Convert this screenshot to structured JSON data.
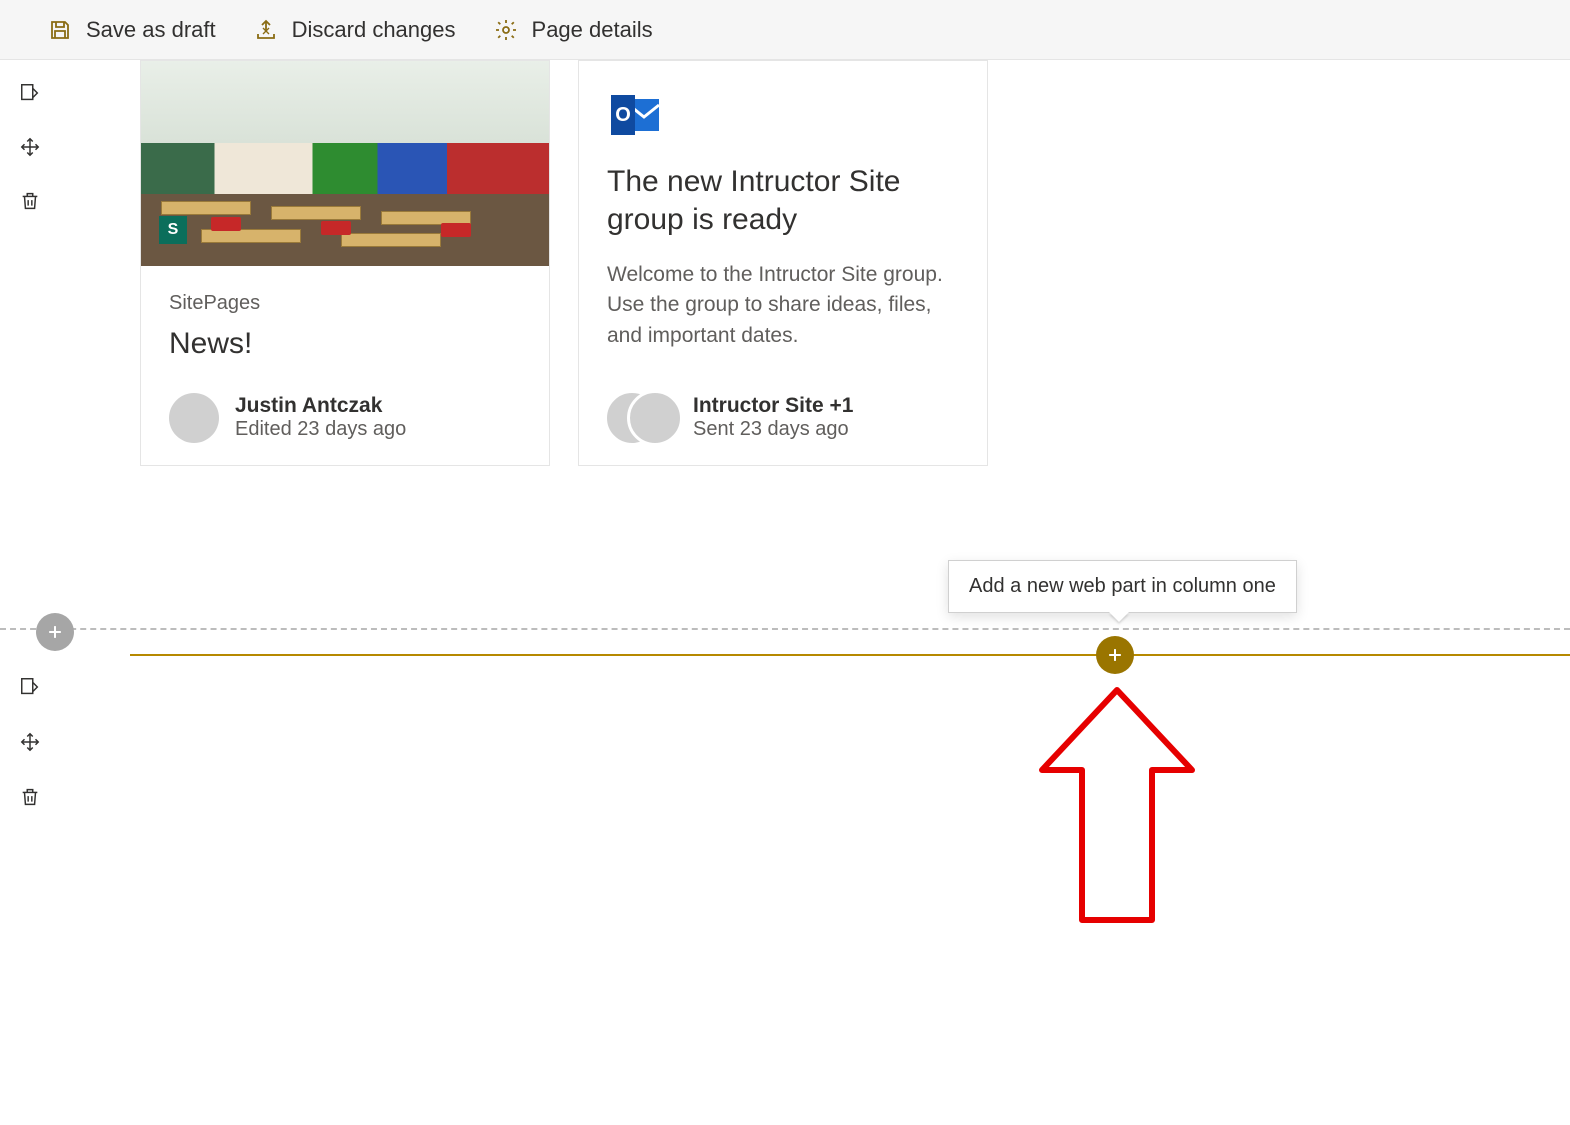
{
  "toolbar": {
    "save_label": "Save as draft",
    "discard_label": "Discard changes",
    "details_label": "Page details"
  },
  "cards": [
    {
      "site_label": "SitePages",
      "title": "News!",
      "author": "Justin Antczak",
      "timestamp": "Edited 23 days ago",
      "media_badge": "S"
    },
    {
      "icon": "outlook",
      "title": "The new Intructor Site group is ready",
      "description": "Welcome to the Intructor Site group. Use the group to share ideas, files, and important dates.",
      "author": "Intructor Site +1",
      "timestamp": "Sent 23 days ago"
    }
  ],
  "tooltip": {
    "add_webpart": "Add a new web part in column one"
  },
  "colors": {
    "accent": "#9a7500",
    "annotation": "#e60000"
  }
}
